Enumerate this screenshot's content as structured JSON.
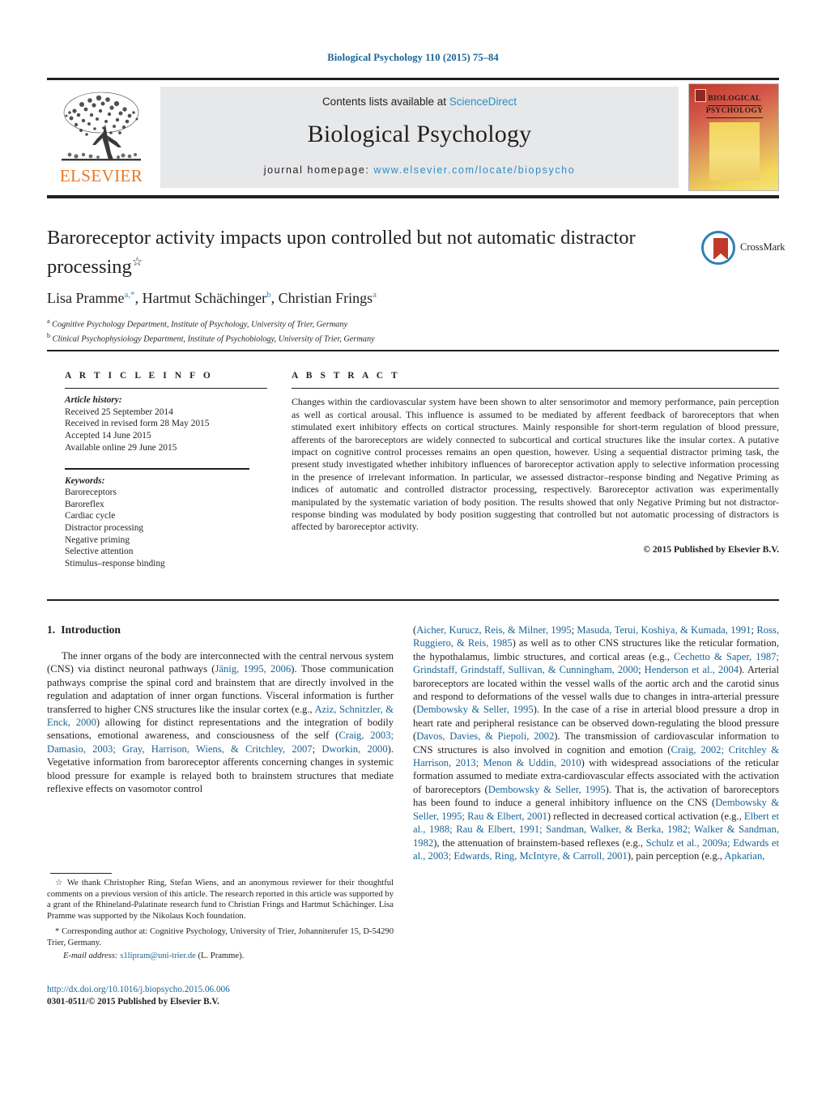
{
  "running_head": "Biological Psychology 110 (2015) 75–84",
  "masthead": {
    "contents_prefix": "Contents lists available at ",
    "sciencedirect": "ScienceDirect",
    "journal_title": "Biological Psychology",
    "homepage_prefix": "journal homepage: ",
    "homepage_url": "www.elsevier.com/locate/biopsycho",
    "publisher_logo_text": "ELSEVIER",
    "cover_line_1": "BIOLOGICAL",
    "cover_line_2": "PSYCHOLOGY"
  },
  "crossmark": {
    "label": "CrossMark"
  },
  "article": {
    "title": "Baroreceptor activity impacts upon controlled but not automatic distractor processing",
    "title_marker": "☆",
    "authors": "Lisa Pramme, Hartmut Schächinger, Christian Frings",
    "author_parts": [
      {
        "name": "Lisa Pramme",
        "sup": "a,*"
      },
      {
        "name": "Hartmut Schächinger",
        "sup": "b"
      },
      {
        "name": "Christian Frings",
        "sup": "a"
      }
    ],
    "affiliations": [
      {
        "sup": "a",
        "text": "Cognitive Psychology Department, Institute of Psychology, University of Trier, Germany"
      },
      {
        "sup": "b",
        "text": "Clinical Psychophysiology Department, Institute of Psychobiology, University of Trier, Germany"
      }
    ]
  },
  "article_info": {
    "heading": "A R T I C L E   I N F O",
    "history_label": "Article history:",
    "history": [
      "Received 25 September 2014",
      "Received in revised form 28 May 2015",
      "Accepted 14 June 2015",
      "Available online 29 June 2015"
    ],
    "keywords_label": "Keywords:",
    "keywords": [
      "Baroreceptors",
      "Baroreflex",
      "Cardiac cycle",
      "Distractor processing",
      "Negative priming",
      "Selective attention",
      "Stimulus–response binding"
    ]
  },
  "abstract": {
    "heading": "A B S T R A C T",
    "text": "Changes within the cardiovascular system have been shown to alter sensorimotor and memory performance, pain perception as well as cortical arousal. This influence is assumed to be mediated by afferent feedback of baroreceptors that when stimulated exert inhibitory effects on cortical structures. Mainly responsible for short-term regulation of blood pressure, afferents of the baroreceptors are widely connected to subcortical and cortical structures like the insular cortex. A putative impact on cognitive control processes remains an open question, however. Using a sequential distractor priming task, the present study investigated whether inhibitory influences of baroreceptor activation apply to selective information processing in the presence of irrelevant information. In particular, we assessed distractor–response binding and Negative Priming as indices of automatic and controlled distractor processing, respectively. Baroreceptor activation was experimentally manipulated by the systematic variation of body position. The results showed that only Negative Priming but not distractor-response binding was modulated by body position suggesting that controlled but not automatic processing of distractors is affected by baroreceptor activity.",
    "copyright": "© 2015 Published by Elsevier B.V."
  },
  "introduction": {
    "number": "1.",
    "heading": "Introduction",
    "left_paragraph_parts": [
      {
        "t": "The inner organs of the body are interconnected with the central nervous system (CNS) via distinct neuronal pathways (",
        "ref": false
      },
      {
        "t": "Jänig, 1995, 2006",
        "ref": true
      },
      {
        "t": "). Those communication pathways comprise the spinal cord and brainstem that are directly involved in the regulation and adaptation of inner organ functions. Visceral information is further transferred to higher CNS structures like the insular cortex (e.g., ",
        "ref": false
      },
      {
        "t": "Aziz, Schnitzler, & Enck, 2000",
        "ref": true
      },
      {
        "t": ") allowing for distinct representations and the integration of bodily sensations, emotional awareness, and consciousness of the self (",
        "ref": false
      },
      {
        "t": "Craig, 2003; Damasio, 2003; Gray, Harrison, Wiens, & Critchley, 2007",
        "ref": true
      },
      {
        "t": "; ",
        "ref": false
      },
      {
        "t": "Dworkin, 2000",
        "ref": true
      },
      {
        "t": "). Vegetative information from baroreceptor afferents concerning changes in systemic blood pressure for example is relayed both to brainstem structures that mediate reflexive effects on vasomotor control",
        "ref": false
      }
    ],
    "right_paragraph_parts": [
      {
        "t": "(",
        "ref": false
      },
      {
        "t": "Aicher, Kurucz, Reis, & Milner, 1995",
        "ref": true
      },
      {
        "t": "; ",
        "ref": false
      },
      {
        "t": "Masuda, Terui, Koshiya, & Kumada, 1991",
        "ref": true
      },
      {
        "t": "; ",
        "ref": false
      },
      {
        "t": "Ross, Ruggiero, & Reis, 1985",
        "ref": true
      },
      {
        "t": ") as well as to other CNS structures like the reticular formation, the hypothalamus, limbic structures, and cortical areas (e.g., ",
        "ref": false
      },
      {
        "t": "Cechetto & Saper, 1987; Grindstaff, Grindstaff, Sullivan, & Cunningham, 2000",
        "ref": true
      },
      {
        "t": "; ",
        "ref": false
      },
      {
        "t": "Henderson et al., 2004",
        "ref": true
      },
      {
        "t": "). Arterial baroreceptors are located within the vessel walls of the aortic arch and the carotid sinus and respond to deformations of the vessel walls due to changes in intra-arterial pressure (",
        "ref": false
      },
      {
        "t": "Dembowsky & Seller, 1995",
        "ref": true
      },
      {
        "t": "). In the case of a rise in arterial blood pressure a drop in heart rate and peripheral resistance can be observed down-regulating the blood pressure (",
        "ref": false
      },
      {
        "t": "Davos, Davies, & Piepoli, 2002",
        "ref": true
      },
      {
        "t": "). The transmission of cardiovascular information to CNS structures is also involved in cognition and emotion (",
        "ref": false
      },
      {
        "t": "Craig, 2002; Critchley & Harrison, 2013; Menon & Uddin, 2010",
        "ref": true
      },
      {
        "t": ") with widespread associations of the reticular formation assumed to mediate extra-cardiovascular effects associated with the activation of baroreceptors (",
        "ref": false
      },
      {
        "t": "Dembowsky & Seller, 1995",
        "ref": true
      },
      {
        "t": "). That is, the activation of baroreceptors has been found to induce a general inhibitory influence on the CNS (",
        "ref": false
      },
      {
        "t": "Dembowsky & Seller, 1995; Rau & Elbert, 2001",
        "ref": true
      },
      {
        "t": ") reflected in decreased cortical activation (e.g., ",
        "ref": false
      },
      {
        "t": "Elbert et al., 1988; Rau & Elbert, 1991; Sandman, Walker, & Berka, 1982; Walker & Sandman, 1982",
        "ref": true
      },
      {
        "t": "), the attenuation of brainstem-based reflexes (e.g., ",
        "ref": false
      },
      {
        "t": "Schulz et al., 2009a; Edwards et al., 2003; Edwards, Ring, McIntyre, & Carroll, 2001",
        "ref": true
      },
      {
        "t": "), pain perception (e.g., ",
        "ref": false
      },
      {
        "t": "Apkarian,",
        "ref": true
      }
    ]
  },
  "footnotes": {
    "marker_star": "☆",
    "note_1": "We thank Christopher Ring, Stefan Wiens, and an anonymous reviewer for their thoughtful comments on a previous version of this article. The research reported in this article was supported by a grant of the Rhineland-Palatinate research fund to Christian Frings and Hartmut Schächinger. Lisa Pramme was supported by the Nikolaus Koch foundation.",
    "marker_asterisk": "*",
    "note_2": "Corresponding author at: Cognitive Psychology, University of Trier, Johanniterufer 15, D-54290 Trier, Germany.",
    "email_label": "E-mail address:",
    "email": "s1lipram@uni-trier.de",
    "email_suffix": "(L. Pramme)."
  },
  "footer": {
    "doi": "http://dx.doi.org/10.1016/j.biopsycho.2015.06.006",
    "issn_line": "0301-0511/© 2015 Published by Elsevier B.V."
  },
  "colors": {
    "link": "#1a6496",
    "sciencedirect": "#2a8fc4",
    "elsevier_orange": "#E87722",
    "rule": "#231f20",
    "masthead_bg": "#e7e8e9"
  }
}
